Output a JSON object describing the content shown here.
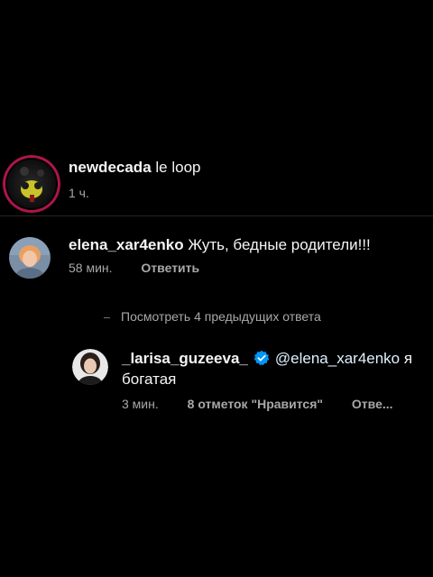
{
  "post": {
    "username": "newdecada",
    "caption": "le loop",
    "time": "1 ч."
  },
  "comment": {
    "username": "elena_xar4enko",
    "text": "Жуть, бедные родители!!!",
    "time": "58 мин.",
    "reply_label": "Ответить"
  },
  "view_replies": {
    "label": "Посмотреть 4 предыдущих ответа"
  },
  "reply": {
    "username": "_larisa_guzeeva_",
    "mention": "@elena_xar4enko",
    "text_after_mention": "я",
    "text_line2": "богатая",
    "time": "3 мин.",
    "likes": "8 отметок \"Нравится\"",
    "reply_label": "Отве...",
    "verified": true
  },
  "colors": {
    "background": "#000000",
    "text_primary": "#f5f5f5",
    "text_secondary": "#a8a8a8",
    "verified_badge": "#0095f6",
    "divider": "#262626"
  }
}
